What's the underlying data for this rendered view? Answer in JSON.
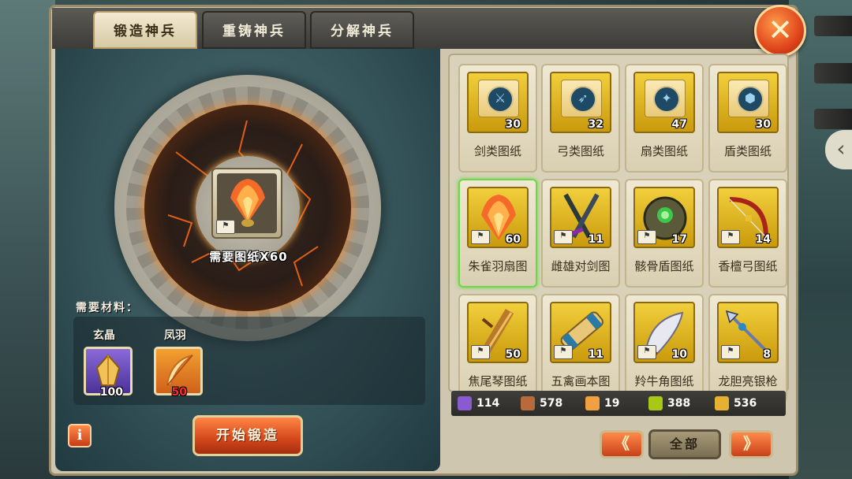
{
  "tabs": [
    {
      "label": "锻造神兵",
      "active": true
    },
    {
      "label": "重铸神兵",
      "active": false
    },
    {
      "label": "分解神兵",
      "active": false
    }
  ],
  "close_label": "✕",
  "forge": {
    "need_text": "需要图纸X60",
    "materials_label": "需要材料：",
    "materials": [
      {
        "name": "玄晶",
        "count": "100",
        "count_color": "#ffffff"
      },
      {
        "name": "凤羽",
        "count": "50",
        "count_color": "#ff2a2a"
      }
    ],
    "info_label": "i",
    "start_button": "开始锻造"
  },
  "items": [
    {
      "name": "剑类图纸",
      "count": "30",
      "kind": "scroll",
      "glyph": "⚔"
    },
    {
      "name": "弓类图纸",
      "count": "32",
      "kind": "scroll",
      "glyph": "➶"
    },
    {
      "name": "扇类图纸",
      "count": "47",
      "kind": "scroll",
      "glyph": "✦"
    },
    {
      "name": "盾类图纸",
      "count": "30",
      "kind": "scroll",
      "glyph": "⬢"
    },
    {
      "name": "朱雀羽扇图",
      "count": "60",
      "kind": "fan",
      "selected": true
    },
    {
      "name": "雌雄对剑图",
      "count": "11",
      "kind": "swords"
    },
    {
      "name": "骸骨盾图纸",
      "count": "17",
      "kind": "shield"
    },
    {
      "name": "香檀弓图纸",
      "count": "14",
      "kind": "bow"
    },
    {
      "name": "焦尾琴图纸",
      "count": "50",
      "kind": "qin"
    },
    {
      "name": "五禽画本图",
      "count": "11",
      "kind": "book"
    },
    {
      "name": "羚牛角图纸",
      "count": "10",
      "kind": "horn"
    },
    {
      "name": "龙胆亮银枪",
      "count": "8",
      "kind": "spear"
    }
  ],
  "resources": [
    {
      "value": "114",
      "icon": "crystal-icon",
      "color": "#8a5ad0"
    },
    {
      "value": "578",
      "icon": "wood-icon",
      "color": "#b86a3a"
    },
    {
      "value": "19",
      "icon": "feather-icon",
      "color": "#f0a040"
    },
    {
      "value": "388",
      "icon": "helmet-icon",
      "color": "#a8c818"
    },
    {
      "value": "536",
      "icon": "gold-feather-icon",
      "color": "#e8b030"
    }
  ],
  "nav": {
    "prev": "《",
    "all": "全部",
    "next": "》"
  },
  "side_arrow": "‹"
}
